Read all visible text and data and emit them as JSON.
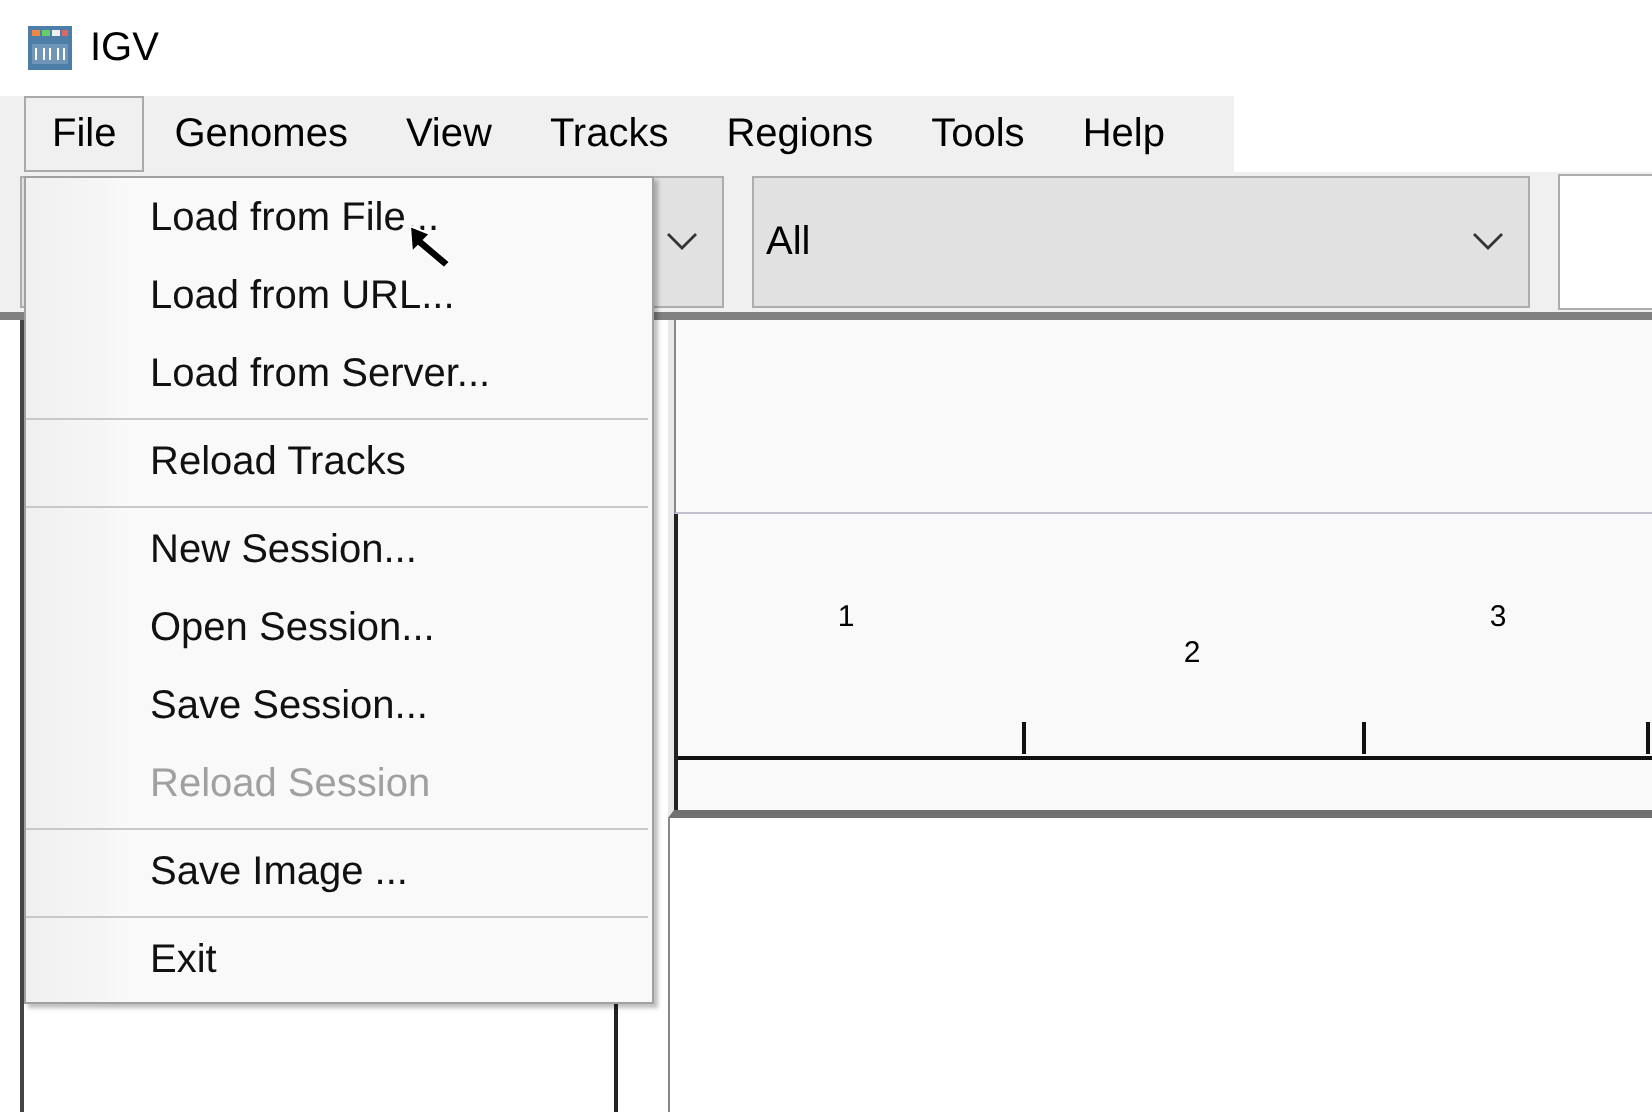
{
  "window": {
    "title": "IGV"
  },
  "menu_bar": [
    {
      "label": "File",
      "selected": true
    },
    {
      "label": "Genomes",
      "selected": false
    },
    {
      "label": "View",
      "selected": false
    },
    {
      "label": "Tracks",
      "selected": false
    },
    {
      "label": "Regions",
      "selected": false
    },
    {
      "label": "Tools",
      "selected": false
    },
    {
      "label": "Help",
      "selected": false
    }
  ],
  "toolbar": {
    "chromosome_combo": {
      "value": "All"
    }
  },
  "ruler": {
    "labels": [
      "1",
      "2",
      "3"
    ]
  },
  "file_menu": {
    "groups": [
      [
        {
          "label": "Load from File...",
          "disabled": false
        },
        {
          "label": "Load from URL...",
          "disabled": false
        },
        {
          "label": "Load from Server...",
          "disabled": false
        }
      ],
      [
        {
          "label": "Reload Tracks",
          "disabled": false
        }
      ],
      [
        {
          "label": "New Session...",
          "disabled": false
        },
        {
          "label": "Open Session...",
          "disabled": false
        },
        {
          "label": "Save Session...",
          "disabled": false
        },
        {
          "label": "Reload Session",
          "disabled": true
        }
      ],
      [
        {
          "label": "Save Image ...",
          "disabled": false
        }
      ],
      [
        {
          "label": "Exit",
          "disabled": false
        }
      ]
    ]
  }
}
